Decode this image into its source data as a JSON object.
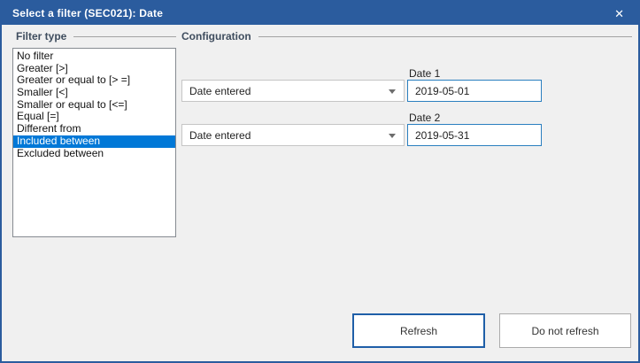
{
  "window": {
    "title": "Select a filter (SEC021): Date",
    "close_icon": "✕"
  },
  "filter_type": {
    "label": "Filter type",
    "selected_index": 7,
    "items": [
      {
        "label": "No filter"
      },
      {
        "label": "Greater [>]"
      },
      {
        "label": "Greater or equal to [> =]"
      },
      {
        "label": "Smaller [<]"
      },
      {
        "label": "Smaller or equal to [<=]"
      },
      {
        "label": "Equal [=]"
      },
      {
        "label": "Different from"
      },
      {
        "label": "Included between"
      },
      {
        "label": "Excluded between"
      }
    ]
  },
  "configuration": {
    "label": "Configuration",
    "rows": [
      {
        "dropdown_value": "Date entered",
        "field_label": "Date 1",
        "field_value": "2019-05-01"
      },
      {
        "dropdown_value": "Date entered",
        "field_label": "Date 2",
        "field_value": "2019-05-31"
      }
    ]
  },
  "footer": {
    "refresh_label": "Refresh",
    "do_not_refresh_label": "Do not refresh"
  },
  "colors": {
    "titlebar": "#2b5c9e",
    "selection": "#0078d7",
    "date_input_border": "#2a7fbf",
    "primary_button_border": "#1f5fa8",
    "dialog_background": "#f0f0f0"
  }
}
